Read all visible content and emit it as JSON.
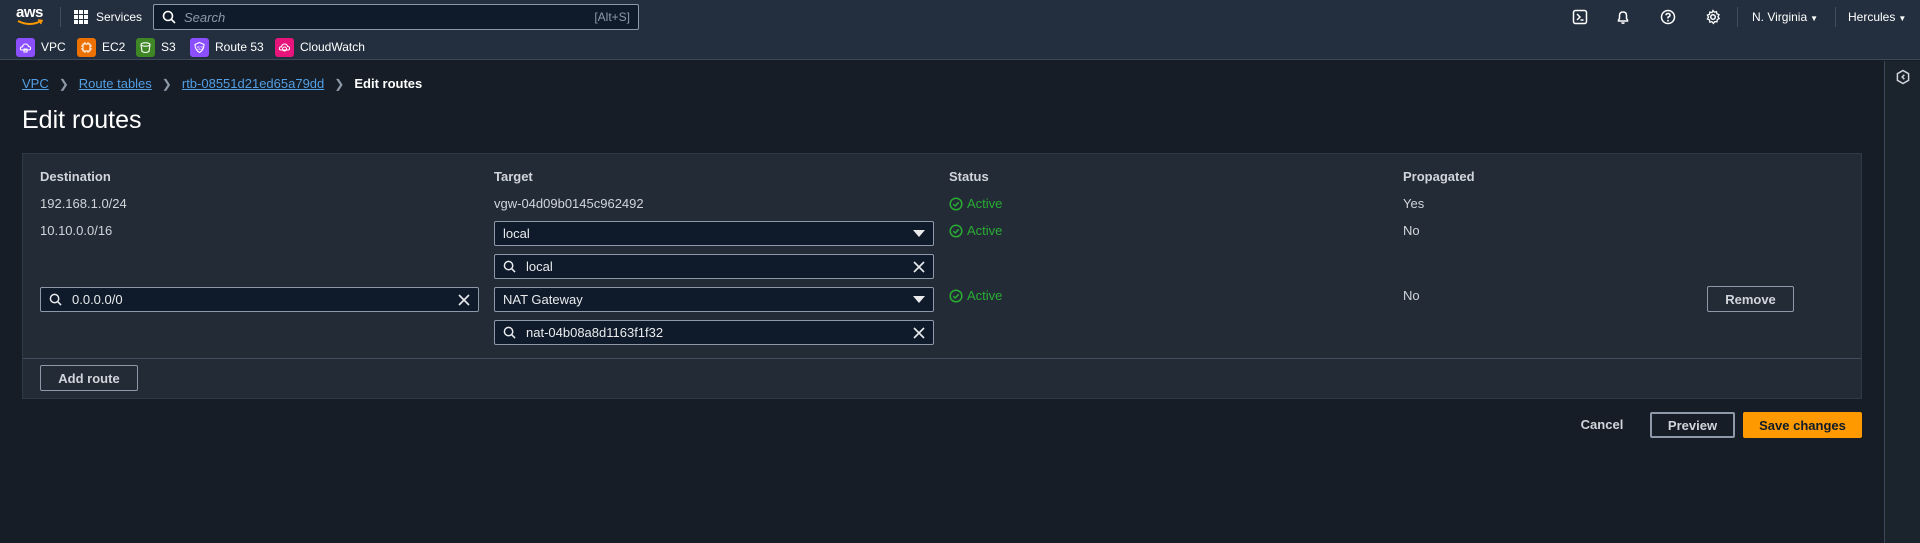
{
  "topnav": {
    "logo_text": "aws",
    "services_label": "Services",
    "search_placeholder": "Search",
    "search_shortcut": "[Alt+S]",
    "region_label": "N. Virginia",
    "user_label": "Hercules",
    "icons": [
      "cloudshell-icon",
      "notifications-icon",
      "help-icon",
      "settings-icon"
    ]
  },
  "favorites": [
    {
      "label": "VPC",
      "color": "#8c4fff"
    },
    {
      "label": "EC2",
      "color": "#ed7100"
    },
    {
      "label": "S3",
      "color": "#3f8624"
    },
    {
      "label": "Route 53",
      "color": "#8c4fff"
    },
    {
      "label": "CloudWatch",
      "color": "#e7157b"
    }
  ],
  "breadcrumb": {
    "items": [
      "VPC",
      "Route tables",
      "rtb-08551d21ed65a79dd"
    ],
    "current": "Edit routes"
  },
  "page_title": "Edit routes",
  "table": {
    "columns": [
      "Destination",
      "Target",
      "Status",
      "Propagated"
    ],
    "rows": [
      {
        "destination": "192.168.1.0/24",
        "target": "vgw-04d09b0145c962492",
        "status": "Active",
        "propagated": "Yes"
      },
      {
        "destination": "10.10.0.0/16",
        "target_type": "local",
        "target_value": "local",
        "status": "Active",
        "propagated": "No"
      },
      {
        "destination": "0.0.0.0/0",
        "target_type": "NAT Gateway",
        "target_value": "nat-04b08a8d1163f1f32",
        "status": "Active",
        "propagated": "No",
        "remove_label": "Remove"
      }
    ],
    "add_route_label": "Add route"
  },
  "footer": {
    "cancel_label": "Cancel",
    "preview_label": "Preview",
    "save_label": "Save changes"
  },
  "colors": {
    "accent": "#ff9900",
    "link": "#539fe5",
    "status_active": "#29ad32",
    "nav_bg": "#232f3e",
    "page_bg": "#161d26"
  }
}
